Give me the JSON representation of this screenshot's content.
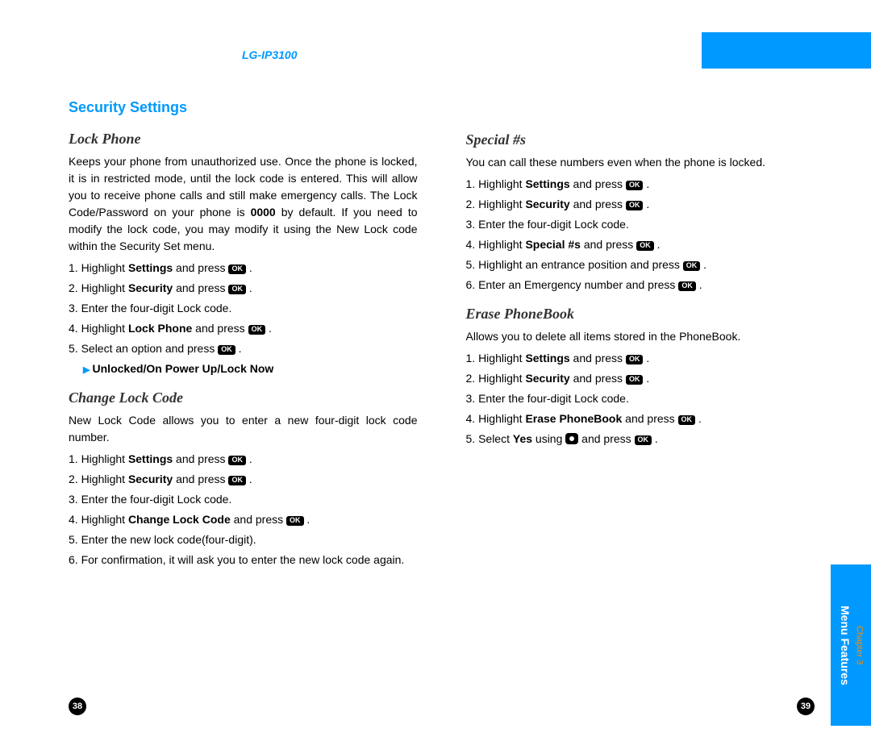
{
  "header": {
    "model": "LG-IP3100"
  },
  "sidebar": {
    "chapter": "Chapter 3",
    "title": "Menu Features"
  },
  "pages": {
    "left": "38",
    "right": "39"
  },
  "ok": "OK",
  "left": {
    "section_title": "Security Settings",
    "lock_phone": {
      "title": "Lock Phone",
      "para": "Keeps your phone from unauthorized use. Once the phone is locked, it is in restricted mode, until the lock code is entered. This will allow you to receive phone calls and still make emergency calls. The Lock Code/Password on your phone is 0000 by default. If you need to modify the lock code, you may modify it using the New Lock code within the Security Set menu.",
      "s1a": "1. Highlight ",
      "s1b": "Settings",
      "s1c": " and press ",
      "s2a": "2. Highlight ",
      "s2b": "Security",
      "s2c": " and press ",
      "s3": "3. Enter the four-digit Lock code.",
      "s4a": "4. Highlight ",
      "s4b": "Lock Phone",
      "s4c": " and press ",
      "s5a": "5. Select an option and press ",
      "bullet": "Unlocked/On Power Up/Lock Now"
    },
    "change_lock": {
      "title": "Change Lock Code",
      "para": "New Lock Code allows you to enter a new four-digit lock code number.",
      "s1a": "1. Highlight ",
      "s1b": "Settings",
      "s1c": " and press ",
      "s2a": "2. Highlight ",
      "s2b": "Security",
      "s2c": " and press ",
      "s3": "3. Enter the four-digit Lock code.",
      "s4a": "4. Highlight ",
      "s4b": "Change Lock Code",
      "s4c": " and press ",
      "s5": "5. Enter the new lock code(four-digit).",
      "s6": "6. For confirmation, it will ask you to enter the new lock code again."
    }
  },
  "right": {
    "special": {
      "title": "Special #s",
      "para": "You can call these numbers even when the phone is locked.",
      "s1a": "1. Highlight ",
      "s1b": "Settings",
      "s1c": " and press ",
      "s2a": "2. Highlight ",
      "s2b": "Security",
      "s2c": " and press ",
      "s3": "3. Enter the four-digit Lock code.",
      "s4a": "4. Highlight ",
      "s4b": "Special #s",
      "s4c": " and press ",
      "s5a": "5. Highlight an entrance position and press ",
      "s6a": "6. Enter an Emergency number and press "
    },
    "erase": {
      "title": "Erase PhoneBook",
      "para": "Allows you to delete all items stored in the PhoneBook.",
      "s1a": "1. Highlight ",
      "s1b": "Settings",
      "s1c": " and press ",
      "s2a": "2. Highlight ",
      "s2b": "Security",
      "s2c": " and press ",
      "s3": "3. Enter the four-digit Lock code.",
      "s4a": "4. Highlight ",
      "s4b": "Erase PhoneBook",
      "s4c": " and press ",
      "s5a": "5. Select ",
      "s5b": "Yes",
      "s5c": " using ",
      "s5d": " and press "
    }
  }
}
